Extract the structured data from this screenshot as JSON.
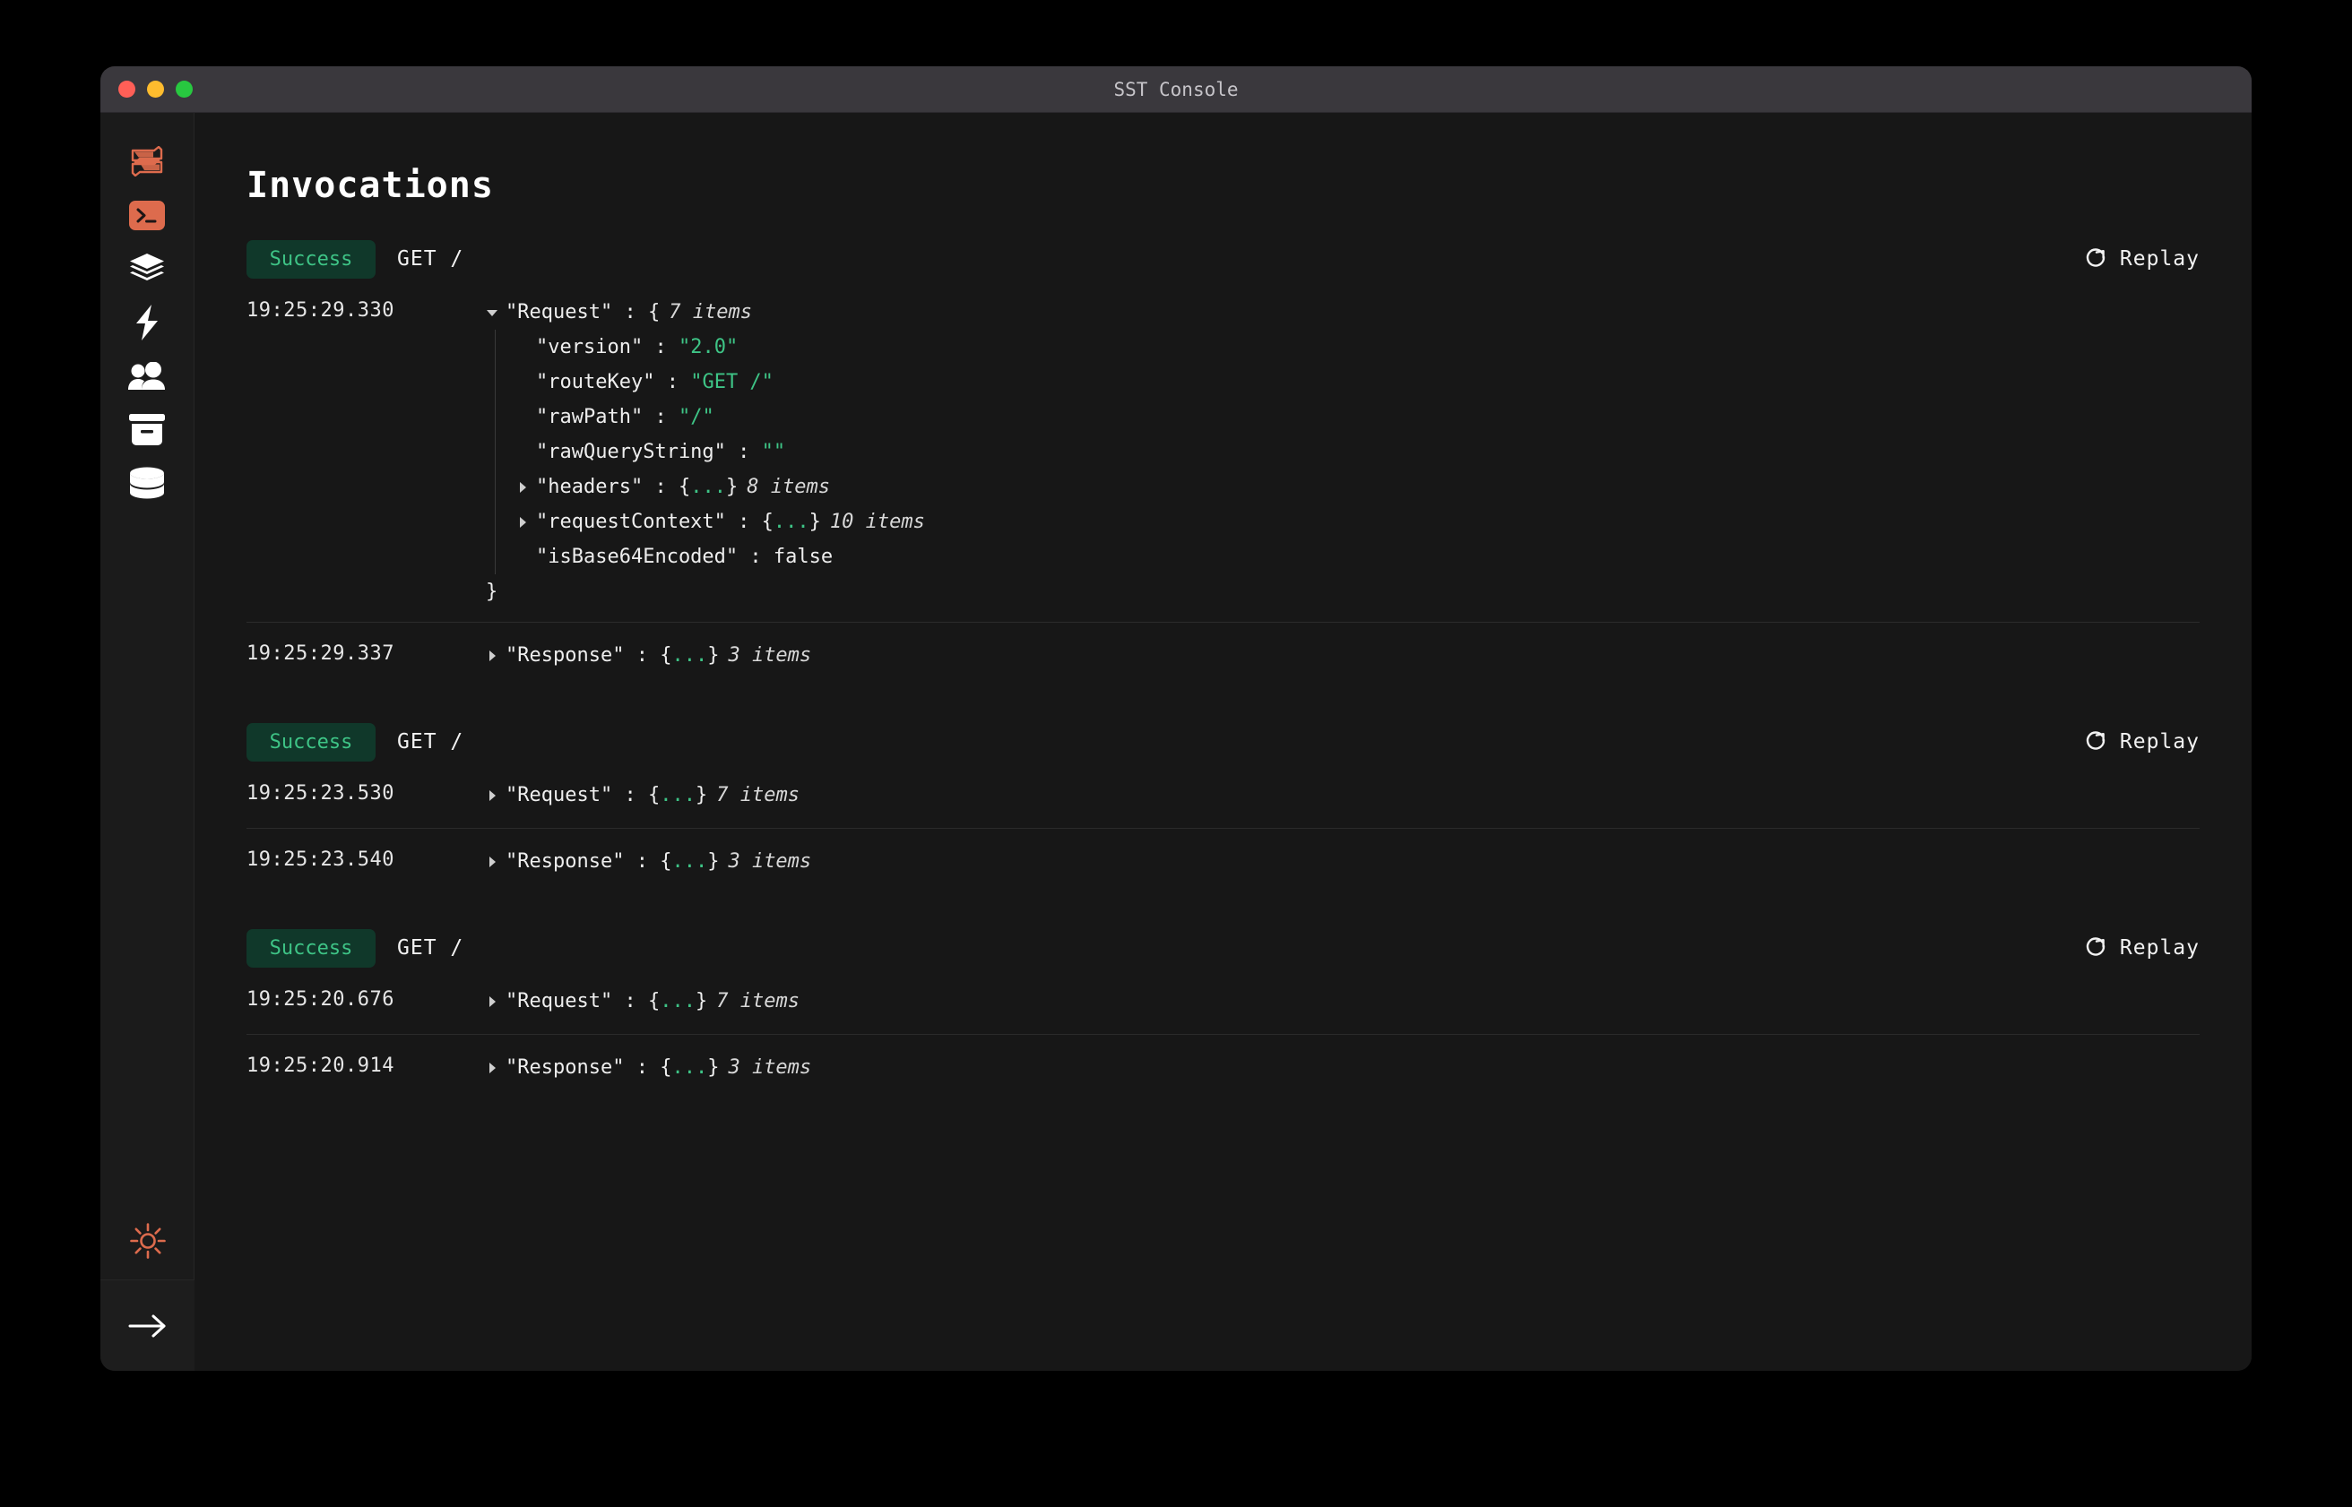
{
  "window": {
    "title": "SST Console",
    "traffic_lights": [
      "close-red",
      "minimize-yellow",
      "maximize-green"
    ]
  },
  "colors": {
    "accent_orange": "#dd6b4d",
    "success_green": "#3ec486",
    "success_bg": "#10382a",
    "window_bg": "#171717",
    "sidebar_bg": "#1b1b1b",
    "titlebar_bg": "#3a383d",
    "string_green": "#3ec486"
  },
  "sidebar": {
    "items": [
      {
        "name": "sst-logo-icon",
        "label": "SST"
      },
      {
        "name": "terminal-icon",
        "label": "Local"
      },
      {
        "name": "stacks-icon",
        "label": "Stacks"
      },
      {
        "name": "functions-bolt-icon",
        "label": "Functions"
      },
      {
        "name": "users-icon",
        "label": "Users"
      },
      {
        "name": "buckets-icon",
        "label": "Buckets"
      },
      {
        "name": "database-icon",
        "label": "Database"
      }
    ],
    "theme_toggle": {
      "name": "sun-icon",
      "label": "Theme"
    },
    "next_button": {
      "name": "arrow-right-icon",
      "label": "Next"
    }
  },
  "main": {
    "page_title": "Invocations",
    "replay_label": "Replay",
    "invocations": [
      {
        "status": "Success",
        "route": "GET /",
        "replay_label": "Replay",
        "request": {
          "timestamp": "19:25:29.330",
          "caret": "expanded",
          "key": "\"Request\"",
          "colon": " : ",
          "open": "{",
          "count": "7 items",
          "children": [
            {
              "caret": "none",
              "key": "\"version\"",
              "colon": " : ",
              "value": "\"2.0\"",
              "value_type": "string"
            },
            {
              "caret": "none",
              "key": "\"routeKey\"",
              "colon": " : ",
              "value": "\"GET /\"",
              "value_type": "string"
            },
            {
              "caret": "none",
              "key": "\"rawPath\"",
              "colon": " : ",
              "value": "\"/\"",
              "value_type": "string"
            },
            {
              "caret": "none",
              "key": "\"rawQueryString\"",
              "colon": " : ",
              "value": "\"\"",
              "value_type": "string"
            },
            {
              "caret": "collapsed",
              "key": "\"headers\"",
              "colon": " : ",
              "value": "{...}",
              "value_type": "object",
              "count": "8 items"
            },
            {
              "caret": "collapsed",
              "key": "\"requestContext\"",
              "colon": " : ",
              "value": "{...}",
              "value_type": "object",
              "count": "10 items"
            },
            {
              "caret": "none",
              "key": "\"isBase64Encoded\"",
              "colon": " : ",
              "value": "false",
              "value_type": "boolean"
            }
          ],
          "close": "}"
        },
        "response": {
          "timestamp": "19:25:29.337",
          "caret": "collapsed",
          "key": "\"Response\"",
          "colon": " : ",
          "value": "{...}",
          "count": "3 items"
        }
      },
      {
        "status": "Success",
        "route": "GET /",
        "replay_label": "Replay",
        "request": {
          "timestamp": "19:25:23.530",
          "caret": "collapsed",
          "key": "\"Request\"",
          "colon": " : ",
          "value": "{...}",
          "count": "7 items"
        },
        "response": {
          "timestamp": "19:25:23.540",
          "caret": "collapsed",
          "key": "\"Response\"",
          "colon": " : ",
          "value": "{...}",
          "count": "3 items"
        }
      },
      {
        "status": "Success",
        "route": "GET /",
        "replay_label": "Replay",
        "request": {
          "timestamp": "19:25:20.676",
          "caret": "collapsed",
          "key": "\"Request\"",
          "colon": " : ",
          "value": "{...}",
          "count": "7 items"
        },
        "response": {
          "timestamp": "19:25:20.914",
          "caret": "collapsed",
          "key": "\"Response\"",
          "colon": " : ",
          "value": "{...}",
          "count": "3 items"
        }
      }
    ]
  }
}
